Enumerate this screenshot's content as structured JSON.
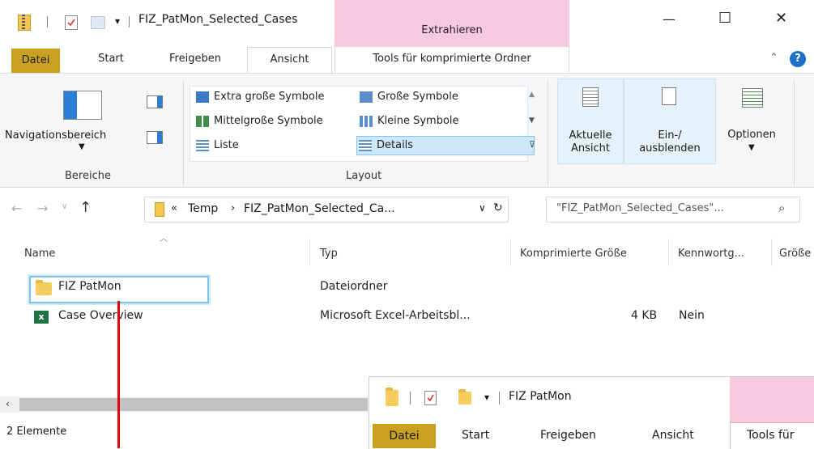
{
  "window": {
    "title": "FIZ_PatMon_Selected_Cases",
    "context_tab": "Extrahieren",
    "controls": [
      "—",
      "☐",
      "✕"
    ]
  },
  "ribbon_tabs": [
    "Datei",
    "Start",
    "Freigeben",
    "Ansicht",
    "Tools für komprimierte Ordner"
  ],
  "ribbon": {
    "bereiche": {
      "nav_label": "Navigationsbereich",
      "group_label": "Bereiche"
    },
    "layout": {
      "items": [
        "Extra große Symbole",
        "Große Symbole",
        "Mittelgroße Symbole",
        "Kleine Symbole",
        "Liste",
        "Details"
      ],
      "group_label": "Layout"
    },
    "aktuelle_ansicht": "Aktuelle Ansicht",
    "ein_ausblenden": "Ein-/ ausblenden",
    "optionen": "Optionen"
  },
  "address": {
    "path": [
      "Temp",
      "FIZ_PatMon_Selected_Ca..."
    ],
    "prefix": "«",
    "search_placeholder": "\"FIZ_PatMon_Selected_Cases\"..."
  },
  "columns": [
    "Name",
    "Typ",
    "Komprimierte Größe",
    "Kennwortg...",
    "Größe"
  ],
  "rows": [
    {
      "name": "FIZ PatMon",
      "typ": "Dateiordner",
      "size": "",
      "pw": ""
    },
    {
      "name": "Case Overview",
      "typ": "Microsoft Excel-Arbeitsbl...",
      "size": "4 KB",
      "pw": "Nein"
    }
  ],
  "status": "2 Elemente",
  "overlay": {
    "title": "FIZ PatMon",
    "tabs": [
      "Datei",
      "Start",
      "Freigeben",
      "Ansicht",
      "Tools für"
    ]
  },
  "colors": {
    "datei_tab": "#c9a11e",
    "context_tab": "#f7c9dd",
    "selection": "#9fd2ef",
    "annotation_line": "#e00000"
  }
}
